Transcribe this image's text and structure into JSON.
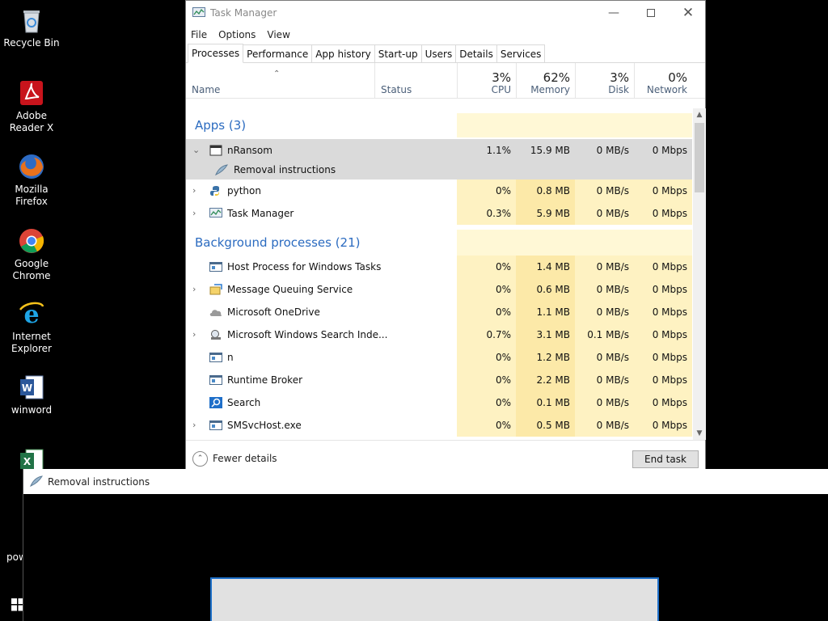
{
  "desktop": {
    "icons": [
      {
        "label": "Recycle Bin",
        "icon": "recycle-bin-icon"
      },
      {
        "label": "Adobe Reader X",
        "icon": "adobe-reader-icon"
      },
      {
        "label": "Mozilla Firefox",
        "icon": "firefox-icon"
      },
      {
        "label": "Google Chrome",
        "icon": "chrome-icon"
      },
      {
        "label": "Internet Explorer",
        "icon": "internet-explorer-icon"
      },
      {
        "label": "winword",
        "icon": "word-icon"
      },
      {
        "label": "pow",
        "icon": "powerpoint-icon"
      }
    ]
  },
  "task_manager": {
    "title": "Task Manager",
    "menu": [
      "File",
      "Options",
      "View"
    ],
    "tabs": [
      "Processes",
      "Performance",
      "App history",
      "Start-up",
      "Users",
      "Details",
      "Services"
    ],
    "active_tab": "Processes",
    "columns": {
      "name": "Name",
      "status": "Status",
      "cpu": {
        "pct": "3%",
        "label": "CPU"
      },
      "memory": {
        "pct": "62%",
        "label": "Memory"
      },
      "disk": {
        "pct": "3%",
        "label": "Disk"
      },
      "network": {
        "pct": "0%",
        "label": "Network"
      }
    },
    "groups": {
      "apps": "Apps (3)",
      "background": "Background processes (21)"
    },
    "apps": [
      {
        "name": "nRansom",
        "cpu": "1.1%",
        "mem": "15.9 MB",
        "disk": "0 MB/s",
        "net": "0 Mbps",
        "expanded": true
      },
      {
        "name": "Removal instructions",
        "child": true
      },
      {
        "name": "python",
        "cpu": "0%",
        "mem": "0.8 MB",
        "disk": "0 MB/s",
        "net": "0 Mbps"
      },
      {
        "name": "Task Manager",
        "cpu": "0.3%",
        "mem": "5.9 MB",
        "disk": "0 MB/s",
        "net": "0 Mbps"
      }
    ],
    "background": [
      {
        "name": "Host Process for Windows Tasks",
        "cpu": "0%",
        "mem": "1.4 MB",
        "disk": "0 MB/s",
        "net": "0 Mbps"
      },
      {
        "name": "Message Queuing Service",
        "cpu": "0%",
        "mem": "0.6 MB",
        "disk": "0 MB/s",
        "net": "0 Mbps"
      },
      {
        "name": "Microsoft OneDrive",
        "cpu": "0%",
        "mem": "1.1 MB",
        "disk": "0 MB/s",
        "net": "0 Mbps"
      },
      {
        "name": "Microsoft Windows Search Inde...",
        "cpu": "0.7%",
        "mem": "3.1 MB",
        "disk": "0.1 MB/s",
        "net": "0 Mbps"
      },
      {
        "name": "n",
        "cpu": "0%",
        "mem": "1.2 MB",
        "disk": "0 MB/s",
        "net": "0 Mbps"
      },
      {
        "name": "Runtime Broker",
        "cpu": "0%",
        "mem": "2.2 MB",
        "disk": "0 MB/s",
        "net": "0 Mbps"
      },
      {
        "name": "Search",
        "cpu": "0%",
        "mem": "0.1 MB",
        "disk": "0 MB/s",
        "net": "0 Mbps"
      },
      {
        "name": "SMSvcHost.exe",
        "cpu": "0%",
        "mem": "0.5 MB",
        "disk": "0 MB/s",
        "net": "0 Mbps"
      }
    ],
    "footer": {
      "fewer_details": "Fewer details",
      "end_task": "End task"
    }
  },
  "removal_window": {
    "title": "Removal instructions"
  },
  "colors": {
    "heat_light": "#fff8d6",
    "heat_mid": "#fef2c2",
    "heat_strong": "#fce9a8",
    "selected_row": "#dadada",
    "group_blue": "#2b6bc0",
    "accent_blue": "#1e70c9"
  }
}
